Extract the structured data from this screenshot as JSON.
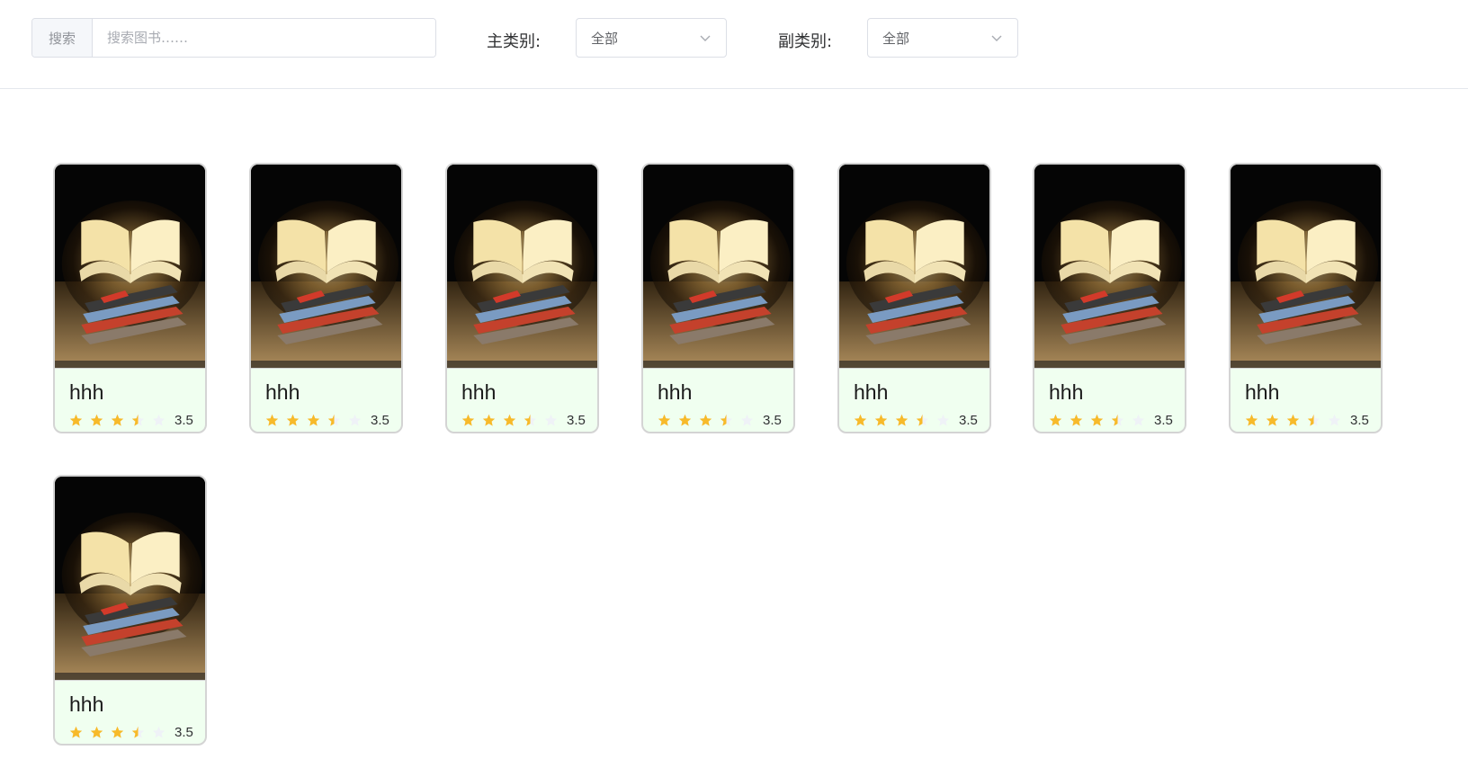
{
  "search": {
    "prefix": "搜索",
    "placeholder": "搜索图书……",
    "value": ""
  },
  "filters": {
    "main_category": {
      "label": "主类别:",
      "selected": "全部"
    },
    "sub_category": {
      "label": "副类别:",
      "selected": "全部"
    }
  },
  "books": [
    {
      "title": "hhh",
      "rating": 3.5,
      "rating_text": "3.5",
      "cover_icon": "book-cover-image"
    },
    {
      "title": "hhh",
      "rating": 3.5,
      "rating_text": "3.5",
      "cover_icon": "book-cover-image"
    },
    {
      "title": "hhh",
      "rating": 3.5,
      "rating_text": "3.5",
      "cover_icon": "book-cover-image"
    },
    {
      "title": "hhh",
      "rating": 3.5,
      "rating_text": "3.5",
      "cover_icon": "book-cover-image"
    },
    {
      "title": "hhh",
      "rating": 3.5,
      "rating_text": "3.5",
      "cover_icon": "book-cover-image"
    },
    {
      "title": "hhh",
      "rating": 3.5,
      "rating_text": "3.5",
      "cover_icon": "book-cover-image"
    },
    {
      "title": "hhh",
      "rating": 3.5,
      "rating_text": "3.5",
      "cover_icon": "book-cover-image"
    },
    {
      "title": "hhh",
      "rating": 3.5,
      "rating_text": "3.5",
      "cover_icon": "book-cover-image"
    }
  ],
  "colors": {
    "star_filled": "#f7ba2a",
    "star_empty": "#eff2f7",
    "card_info_bg": "#f0fff0",
    "border": "#dcdfe6"
  }
}
